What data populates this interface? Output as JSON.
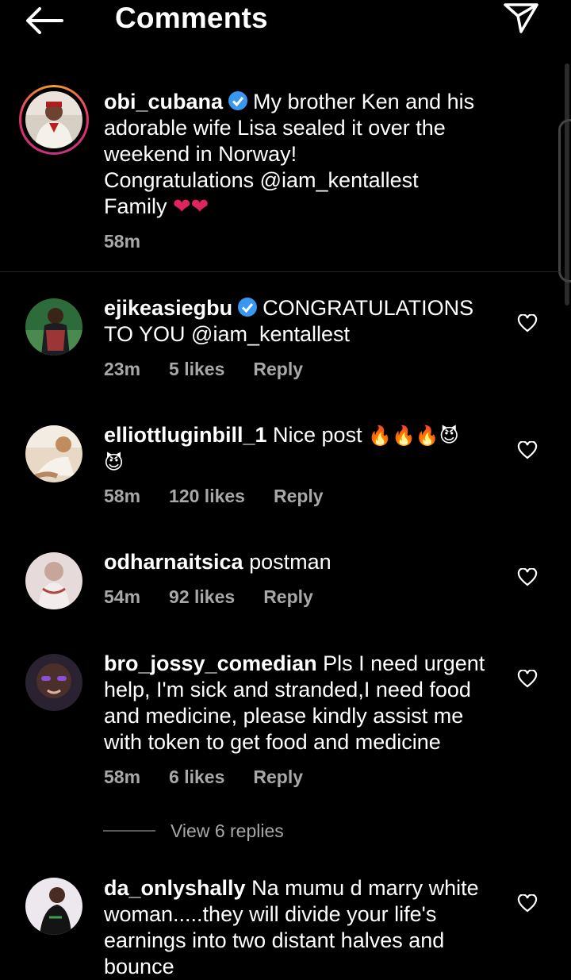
{
  "header": {
    "title": "Comments"
  },
  "caption": {
    "username": "obi_cubana",
    "text_line1": "My brother Ken and his",
    "text_line2": "adorable wife Lisa sealed it over the",
    "text_line3": "weekend in Norway!",
    "text_line4": "Congratulations @iam_kentallest",
    "text_line5": "Family",
    "hearts": "❤❤",
    "time": "58m"
  },
  "comments": [
    {
      "username": "ejikeasiegbu",
      "text_line1": "CONGRATULATIONS",
      "text_line2": "TO YOU @iam_kentallest",
      "time": "23m",
      "likes": "5 likes",
      "reply": "Reply"
    },
    {
      "username": "elliottluginbill_1",
      "text_line1": "Nice post",
      "emojis_line1": "🔥🔥🔥😈",
      "emojis_line2": "😈",
      "time": "58m",
      "likes": "120 likes",
      "reply": "Reply"
    },
    {
      "username": "odharnaitsica",
      "text_line1": "postman",
      "time": "54m",
      "likes": "92 likes",
      "reply": "Reply"
    },
    {
      "username": "bro_jossy_comedian",
      "text_line1": "Pls I need urgent",
      "text_line2": "help, I'm sick and stranded,I need food",
      "text_line3": "and medicine, please kindly assist me",
      "text_line4": "with token to get food and medicine",
      "time": "58m",
      "likes": "6 likes",
      "reply": "Reply",
      "view_replies": "View 6 replies"
    },
    {
      "username": "da_onlyshally",
      "text_line1": "Na mumu d marry white",
      "text_line2": "woman.....they will divide your life's",
      "text_line3": "earnings into two distant halves and",
      "text_line4": "bounce"
    }
  ],
  "colors": {
    "background": "#000000",
    "muted": "#a8a8a8",
    "verified": "#3897f0",
    "heart_red": "#e0245e"
  }
}
